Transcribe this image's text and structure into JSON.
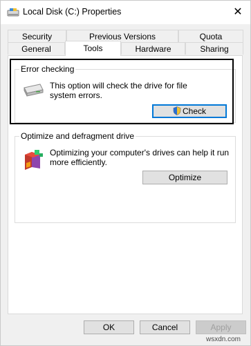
{
  "window": {
    "title": "Local Disk (C:) Properties",
    "close_glyph": "✕"
  },
  "tabs": {
    "row1": [
      "Security",
      "Previous Versions",
      "Quota"
    ],
    "row2": [
      "General",
      "Tools",
      "Hardware",
      "Sharing"
    ],
    "active": "Tools"
  },
  "error_checking": {
    "title": "Error checking",
    "description_line1": "This option will check the drive for file",
    "description_line2": "system errors.",
    "check_button": "Check",
    "icon": "drive-icon",
    "button_icon": "shield-icon"
  },
  "optimize": {
    "title": "Optimize and defragment drive",
    "description_line1": "Optimizing your computer's drives can help it run",
    "description_line2": "more efficiently.",
    "optimize_button": "Optimize",
    "icon": "defrag-icon"
  },
  "footer": {
    "ok": "OK",
    "cancel": "Cancel",
    "apply": "Apply"
  },
  "watermark": "wsxdn.com",
  "colors": {
    "accent": "#0078d7",
    "highlight_border": "#000000",
    "dialog_bg": "#f0f0f0"
  }
}
